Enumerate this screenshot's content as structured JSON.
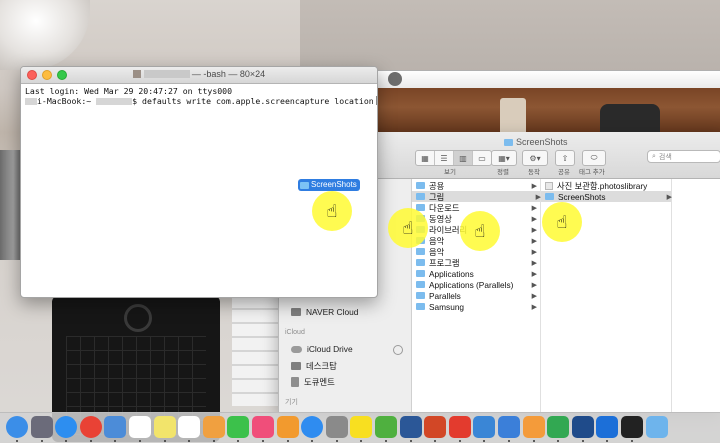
{
  "terminal": {
    "title_suffix": "— -bash — 80×24",
    "last_login": "Last login: Wed Mar 29 20:47:27 on ttys000",
    "prompt_host": "i-MacBook:~",
    "command": "$ defaults write com.apple.screencapture location"
  },
  "drag_folder": {
    "label": "ScreenShots"
  },
  "finder": {
    "title": "ScreenShots",
    "toolbar": {
      "view_label": "보기",
      "arrange_label": "정렬",
      "action_label": "동작",
      "share_label": "공유",
      "tags_label": "태그 추가",
      "search_placeholder": "검색"
    },
    "sidebar": {
      "items_top": [
        {
          "label": "NAVER Cloud",
          "icon": "folder-icon"
        }
      ],
      "icloud_header": "iCloud",
      "icloud_items": [
        {
          "label": "iCloud Drive",
          "icon": "cloud-icon"
        },
        {
          "label": "데스크탑",
          "icon": "desktop-icon"
        },
        {
          "label": "도큐멘트",
          "icon": "document-icon"
        }
      ],
      "devices_header": "기기"
    },
    "column1": [
      "공용",
      "그림",
      "다운로드",
      "동영상",
      "라이브러리",
      "음악",
      "음악",
      "프로그램",
      "Applications",
      "Applications (Parallels)",
      "Parallels",
      "Samsung"
    ],
    "column1_display": [
      "공용",
      "그림",
      "다운로드",
      "동영상",
      "라이브러리",
      "음악",
      "음악",
      "프로그램",
      "Applications",
      "Applications (Parallels)",
      "Parallels",
      "Samsung"
    ],
    "column2": [
      "사진 보관함.photoslibrary",
      "ScreenShots"
    ]
  },
  "colors": {
    "selection_blue": "#2f7de1",
    "cursor_highlight": "#fff832",
    "folder_blue": "#7cbcee"
  },
  "dock": {
    "icons": [
      "finder-icon",
      "launchpad-icon",
      "safari-icon",
      "chrome-icon",
      "preview-icon",
      "calendar-icon",
      "notes-icon",
      "reminders-icon",
      "photos-icon",
      "facetime-icon",
      "itunes-icon",
      "ibooks-icon",
      "appstore-icon",
      "system-preferences-icon",
      "kakaotalk-icon",
      "evernote-icon",
      "word-icon",
      "powerpoint-icon",
      "parallels-icon",
      "xcode-icon",
      "keynote-icon",
      "pages-icon",
      "numbers-icon",
      "photoshop-icon",
      "onedrive-icon",
      "terminal-icon",
      "folder-icon"
    ]
  }
}
